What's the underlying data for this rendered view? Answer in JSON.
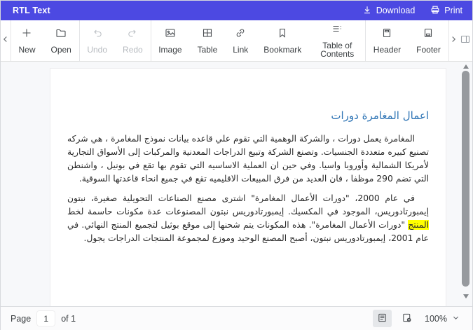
{
  "titlebar": {
    "title": "RTL Text",
    "download_label": "Download",
    "print_label": "Print",
    "bg_color": "#4C49E2"
  },
  "toolbar": {
    "new_label": "New",
    "open_label": "Open",
    "undo_label": "Undo",
    "redo_label": "Redo",
    "image_label": "Image",
    "table_label": "Table",
    "link_label": "Link",
    "bookmark_label": "Bookmark",
    "toc_label": "Table of Contents",
    "header_label": "Header",
    "footer_label": "Footer"
  },
  "document": {
    "heading": "اعمال المغامرة دورات",
    "heading_color": "#2E74B5",
    "paragraph1": "المغامرة يعمل دورات ، والشركة الوهمية التي تقوم علي قاعده بيانات نموذج المغامرة ، هي شركه تصنيع كبيره متعددة الجنسيات. وتصنع الشركة وتبيع الدراجات المعدنية والمركبات إلى الأسواق التجارية لأمريكا الشمالية وأوروبا واسيا. وفي حين ان العملية الاساسيه التي تقوم بها تقع في بونيل ، واشنطن التي تضم 290 موظفا ، فان العديد من فرق المبيعات الاقليميه تقع في جميع انحاء قاعدتها السوقية.",
    "paragraph2_before": "في عام 2000، \"دورات الأعمال المغامرة\" اشترى مصنع الصناعات التحويلية صغيرة، نبتون إيمبورتادوريس، الموجود في المكسيك. إيمبورتادوريس نبتون المصنوعات عدة مكونات حاسمة لخط ",
    "paragraph2_highlight": "المنتج",
    "paragraph2_after": " \"دورات الأعمال المغامرة\". هذه المكونات يتم شحنها إلى موقع بوثيل لتجميع المنتج النهائي. في عام 2001، إيمبورتادوريس نبتون، أصبح المصنع الوحيد وموزع لمجموعة المنتجات الدراجات يجول.",
    "highlight_color": "#FFFF00"
  },
  "statusbar": {
    "page_label": "Page",
    "page_value": "1",
    "of_label": "of 1",
    "zoom_value": "100%"
  }
}
